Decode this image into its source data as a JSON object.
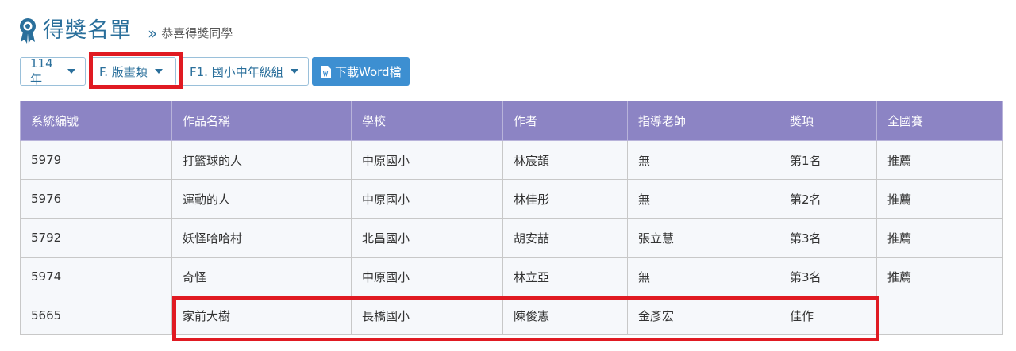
{
  "header": {
    "title": "得獎名單",
    "chevron": "»",
    "subtitle": "恭喜得獎同學"
  },
  "filters": {
    "year": "114年",
    "category": "F. 版畫類",
    "group": "F1. 國小中年級組",
    "download_label": "下載Word檔"
  },
  "table": {
    "columns": [
      "系統編號",
      "作品名稱",
      "學校",
      "作者",
      "指導老師",
      "獎項",
      "全國賽"
    ],
    "rows": [
      [
        "5979",
        "打籃球的人",
        "中原國小",
        "林宸頡",
        "無",
        "第1名",
        "推薦"
      ],
      [
        "5976",
        "運動的人",
        "中原國小",
        "林佳彤",
        "無",
        "第2名",
        "推薦"
      ],
      [
        "5792",
        "妖怪哈哈村",
        "北昌國小",
        "胡安喆",
        "張立慧",
        "第3名",
        "推薦"
      ],
      [
        "5974",
        "奇怪",
        "中原國小",
        "林立亞",
        "無",
        "第3名",
        "推薦"
      ],
      [
        "5665",
        "家前大樹",
        "長橋國小",
        "陳俊憲",
        "金彥宏",
        "佳作",
        ""
      ]
    ]
  },
  "colors": {
    "accent": "#2a6f9b",
    "header_bg": "#8c84c4",
    "button_bg": "#3d8fd1",
    "highlight": "#e01a22"
  },
  "icons": {
    "title": "award-ribbon-icon",
    "dropdown": "caret-down-icon",
    "download": "word-file-icon"
  }
}
